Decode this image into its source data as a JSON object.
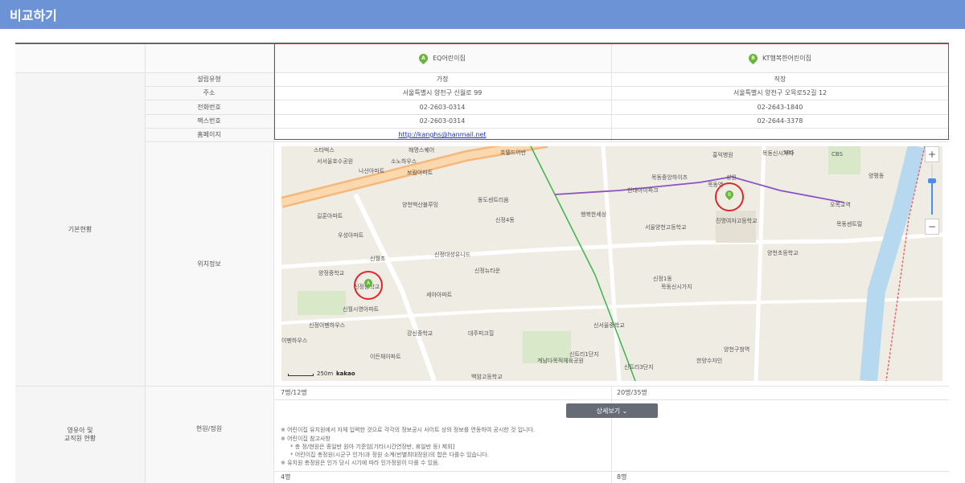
{
  "header": {
    "title": "비교하기"
  },
  "columns": {
    "a": {
      "marker": "A",
      "name": "EQ어린이집"
    },
    "b": {
      "marker": "B",
      "name": "KT행복한어린이집"
    }
  },
  "sections": {
    "basic": "기본현황",
    "staff": "영유아 및\n교직원 현황"
  },
  "rows": [
    {
      "label": "설립유형",
      "a": "가정",
      "b": "직장"
    },
    {
      "label": "주소",
      "a": "서울특별시 양천구 신월로 99",
      "b": "서울특별시 양천구 오목로52길 12"
    },
    {
      "label": "전화번호",
      "a": "02-2603-0314",
      "b": "02-2643-1840"
    },
    {
      "label": "팩스번호",
      "a": "02-2603-0314",
      "b": "02-2644-3378"
    },
    {
      "label": "홈페이지",
      "a": "http://kanghs@hanmail.net",
      "b": ""
    }
  ],
  "location_label": "위치정보",
  "map": {
    "labels": [
      "스타벅스",
      "해명스퀘어",
      "호텔드어반",
      "홍익병원",
      "목동신시가지",
      "SBS",
      "CBS",
      "서서울호수공원",
      "나산아파트",
      "소노하우스",
      "보람아파트",
      "현대아이파크",
      "성원",
      "행복한세상",
      "목동중앙하이츠",
      "목동역",
      "오목교역",
      "신정4동",
      "신정중학교",
      "양정중학교",
      "신월초",
      "신정1동",
      "목동신시가지",
      "양천구청역",
      "신서울중학교",
      "강신중학교",
      "대주피크힐",
      "세아아파트",
      "백암고등학교",
      "신트리1단지",
      "계남다목적체육공원",
      "신트리3단지",
      "신정뉴타운",
      "한양수자인",
      "신월시영아파트",
      "신정이펜하우스",
      "이펜하우스",
      "이든채아파트",
      "우성아파트",
      "길훈아파트",
      "신정대성유니드",
      "양천백산블루밍",
      "동도센트리움",
      "서울양천고등학교",
      "진명여자고등학교",
      "목동센트럴",
      "양평동",
      "양천초등학교"
    ],
    "marker_a": "A",
    "marker_b": "B",
    "scale": "250m",
    "brand": "kakao",
    "zoom_in": "+",
    "zoom_out": "−"
  },
  "staff": {
    "label": "현원/정원",
    "a_value": "7명/12명",
    "b_value": "20명/35명",
    "detail_button": "상세보기 ⌄",
    "notes": [
      "※ 어린이집 유치원에서 자체 입력한 것으로 각각의 정보공시 사이트 상의 정보를 연동하여 공시한 것 입니다.",
      "※ 어린이집 참고사항",
      "* 총 정/현원은 종일반 원아 기준임[기타(시간연장반, 휴일반 등) 제외]",
      "* 어린이집 총정원(시군구 인가)과 정원 소계(반별최대정원)의 합은 다를수 있습니다.",
      "※ 유치원 총정원은 인가 당시 시기에 따라 인가정원이 다를 수 있음."
    ],
    "a_teachers": "4명",
    "b_teachers": "8명"
  }
}
